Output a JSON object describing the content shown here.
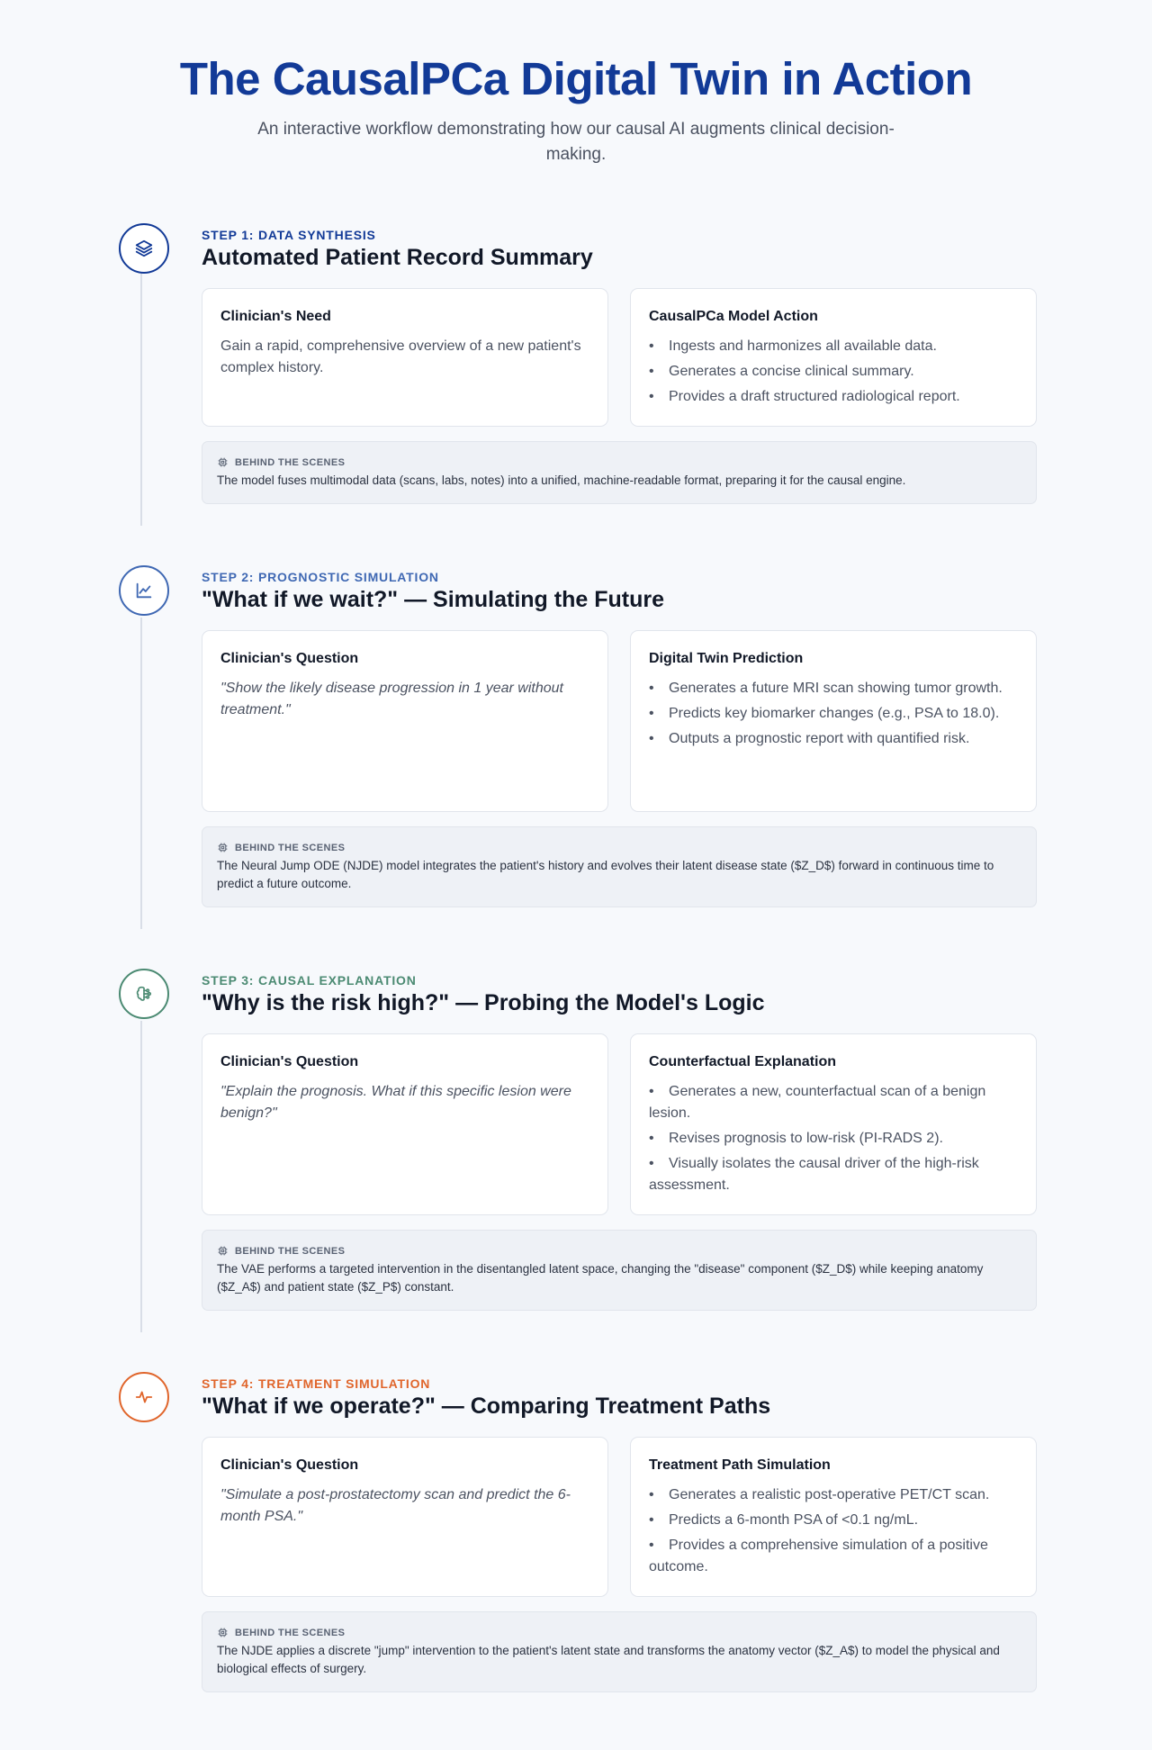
{
  "header": {
    "title": "The CausalPCa Digital Twin in Action",
    "subtitle": "An interactive workflow demonstrating how our causal AI augments clinical decision-making."
  },
  "behind_label": "BEHIND THE SCENES",
  "steps": [
    {
      "label": "STEP 1: DATA SYNTHESIS",
      "title": "Automated Patient Record Summary",
      "color": "#123a97",
      "icon": "layers-icon",
      "left_heading": "Clinician's Need",
      "left_text": "Gain a rapid, comprehensive overview of a new patient's complex history.",
      "right_heading": "CausalPCa Model Action",
      "right_items": [
        "Ingests and harmonizes all available data.",
        "Generates a concise clinical summary.",
        "Provides a draft structured radiological report."
      ],
      "behind_text": "The model fuses multimodal data (scans, labs, notes) into a unified, machine-readable format, preparing it for the causal engine."
    },
    {
      "label": "STEP 2: PROGNOSTIC SIMULATION",
      "title": "\"What if we wait?\" — Simulating the Future",
      "color": "#3f68b3",
      "icon": "line-chart-icon",
      "left_heading": "Clinician's Question",
      "left_text": "\"Show the likely disease progression in 1 year without treatment.\"",
      "right_heading": "Digital Twin Prediction",
      "right_items": [
        "Generates a future MRI scan showing tumor growth.",
        "Predicts key biomarker changes (e.g., PSA to 18.0).",
        "Outputs a prognostic report with quantified risk."
      ],
      "behind_text": "The Neural Jump ODE (NJDE) model integrates the patient's history and evolves their latent disease state ($Z_D$) forward in continuous time to predict a future outcome."
    },
    {
      "label": "STEP 3: CAUSAL EXPLANATION",
      "title": "\"Why is the risk high?\" — Probing the Model's Logic",
      "color": "#4b8a72",
      "icon": "brain-icon",
      "left_heading": "Clinician's Question",
      "left_text": "\"Explain the prognosis. What if this specific lesion were benign?\"",
      "right_heading": "Counterfactual Explanation",
      "right_items": [
        "Generates a new, counterfactual scan of a benign lesion.",
        "Revises prognosis to low-risk (PI-RADS 2).",
        "Visually isolates the causal driver of the high-risk assessment."
      ],
      "behind_text": "The VAE performs a targeted intervention in the disentangled latent space, changing the \"disease\" component ($Z_D$) while keeping anatomy ($Z_A$) and patient state ($Z_P$) constant."
    },
    {
      "label": "STEP 4: TREATMENT SIMULATION",
      "title": "\"What if we operate?\" — Comparing Treatment Paths",
      "color": "#e0652b",
      "icon": "activity-icon",
      "left_heading": "Clinician's Question",
      "left_text": "\"Simulate a post-prostatectomy scan and predict the 6-month PSA.\"",
      "right_heading": "Treatment Path Simulation",
      "right_items": [
        "Generates a realistic post-operative PET/CT scan.",
        "Predicts a 6-month PSA of <0.1 ng/mL.",
        "Provides a comprehensive simulation of a positive outcome."
      ],
      "behind_text": "The NJDE applies a discrete \"jump\" intervention to the patient's latent state and transforms the anatomy vector ($Z_A$) to model the physical and biological effects of surgery."
    }
  ]
}
